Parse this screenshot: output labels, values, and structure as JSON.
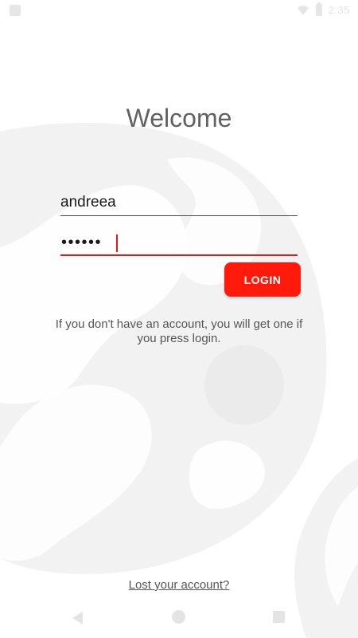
{
  "status_bar": {
    "time": "2:35",
    "icons": [
      "notification-icon",
      "wifi-icon",
      "battery-icon"
    ]
  },
  "login": {
    "title": "Welcome",
    "username_value": "andreea",
    "password_value": "••••••",
    "button_label": "LOGIN",
    "info_text": "If you don't have an account, you will get one if you press login.",
    "lost_account_link": "Lost your account?"
  },
  "colors": {
    "accent": "#ff1a0b",
    "focus_underline": "#e11b1b",
    "title_text": "#616161",
    "background_shape": "#f2f2f2"
  },
  "nav_bar": {
    "icons": [
      "back-icon",
      "home-icon",
      "recents-icon"
    ]
  }
}
